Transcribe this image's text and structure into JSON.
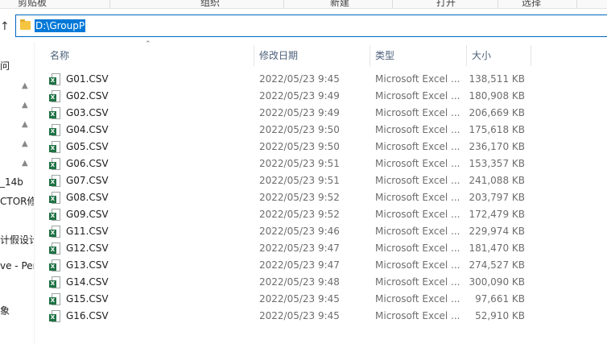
{
  "ribbon": {
    "groups": [
      "剪贴板",
      "组织",
      "新建",
      "打开",
      "选择"
    ]
  },
  "address": {
    "path": "D:\\GroupP"
  },
  "nav_pane": {
    "items": [
      "问",
      "",
      "",
      "",
      "",
      "",
      "",
      "_14b",
      "CTOR修",
      "",
      "计假设计",
      "",
      "ve - Per",
      "",
      "象"
    ]
  },
  "columns": {
    "name": "名称",
    "date": "修改日期",
    "type": "类型",
    "size": "大小"
  },
  "files": [
    {
      "name": "G01.CSV",
      "date": "2022/05/23 9:45",
      "type": "Microsoft Excel ...",
      "size": "138,511 KB"
    },
    {
      "name": "G02.CSV",
      "date": "2022/05/23 9:49",
      "type": "Microsoft Excel ...",
      "size": "180,908 KB"
    },
    {
      "name": "G03.CSV",
      "date": "2022/05/23 9:49",
      "type": "Microsoft Excel ...",
      "size": "206,669 KB"
    },
    {
      "name": "G04.CSV",
      "date": "2022/05/23 9:50",
      "type": "Microsoft Excel ...",
      "size": "175,618 KB"
    },
    {
      "name": "G05.CSV",
      "date": "2022/05/23 9:50",
      "type": "Microsoft Excel ...",
      "size": "236,170 KB"
    },
    {
      "name": "G06.CSV",
      "date": "2022/05/23 9:51",
      "type": "Microsoft Excel ...",
      "size": "153,357 KB"
    },
    {
      "name": "G07.CSV",
      "date": "2022/05/23 9:51",
      "type": "Microsoft Excel ...",
      "size": "241,088 KB"
    },
    {
      "name": "G08.CSV",
      "date": "2022/05/23 9:52",
      "type": "Microsoft Excel ...",
      "size": "203,797 KB"
    },
    {
      "name": "G09.CSV",
      "date": "2022/05/23 9:52",
      "type": "Microsoft Excel ...",
      "size": "172,479 KB"
    },
    {
      "name": "G11.CSV",
      "date": "2022/05/23 9:46",
      "type": "Microsoft Excel ...",
      "size": "229,974 KB"
    },
    {
      "name": "G12.CSV",
      "date": "2022/05/23 9:47",
      "type": "Microsoft Excel ...",
      "size": "181,470 KB"
    },
    {
      "name": "G13.CSV",
      "date": "2022/05/23 9:47",
      "type": "Microsoft Excel ...",
      "size": "274,527 KB"
    },
    {
      "name": "G14.CSV",
      "date": "2022/05/23 9:48",
      "type": "Microsoft Excel ...",
      "size": "300,090 KB"
    },
    {
      "name": "G15.CSV",
      "date": "2022/05/23 9:45",
      "type": "Microsoft Excel ...",
      "size": "97,661 KB"
    },
    {
      "name": "G16.CSV",
      "date": "2022/05/23 9:45",
      "type": "Microsoft Excel ...",
      "size": "52,910 KB"
    }
  ],
  "icons": {
    "file": "excel-csv-icon",
    "folder": "folder-icon",
    "pin": "pin-icon",
    "up": "up-arrow-icon"
  },
  "colors": {
    "selection": "#0078d7",
    "header_text": "#4c607a",
    "excel_green": "#1f7244"
  }
}
